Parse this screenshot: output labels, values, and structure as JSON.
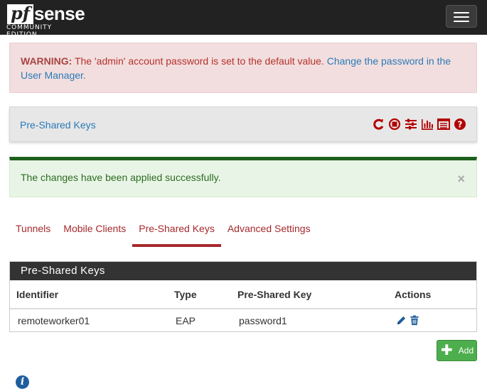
{
  "brand": {
    "logo_pf": "pf",
    "logo_sense": "sense",
    "edition": "COMMUNITY EDITION"
  },
  "warning": {
    "label": "WARNING:",
    "text": " The 'admin' account password is set to the default value. ",
    "link": "Change the password in the User Manager."
  },
  "breadcrumb": {
    "title": "Pre-Shared Keys",
    "icons": [
      "restart-icon",
      "stop-icon",
      "settings-sliders-icon",
      "bar-chart-icon",
      "log-list-icon",
      "help-icon"
    ],
    "icon_color": "#b30000"
  },
  "success": {
    "text": "The changes have been applied successfully.",
    "close": "×"
  },
  "tabs": [
    {
      "label": "Tunnels",
      "active": false
    },
    {
      "label": "Mobile Clients",
      "active": false
    },
    {
      "label": "Pre-Shared Keys",
      "active": true
    },
    {
      "label": "Advanced Settings",
      "active": false
    }
  ],
  "panel": {
    "heading": "Pre-Shared Keys",
    "columns": [
      "Identifier",
      "Type",
      "Pre-Shared Key",
      "Actions"
    ],
    "rows": [
      {
        "identifier": "remoteworker01",
        "type": "EAP",
        "key": "password1"
      }
    ]
  },
  "add_button": {
    "label": "Add"
  },
  "colors": {
    "accent": "#a5282c",
    "link": "#2a7ab8",
    "navbar": "#222222",
    "success_bar": "#1d5f1d",
    "add_green": "#4cae4c"
  }
}
